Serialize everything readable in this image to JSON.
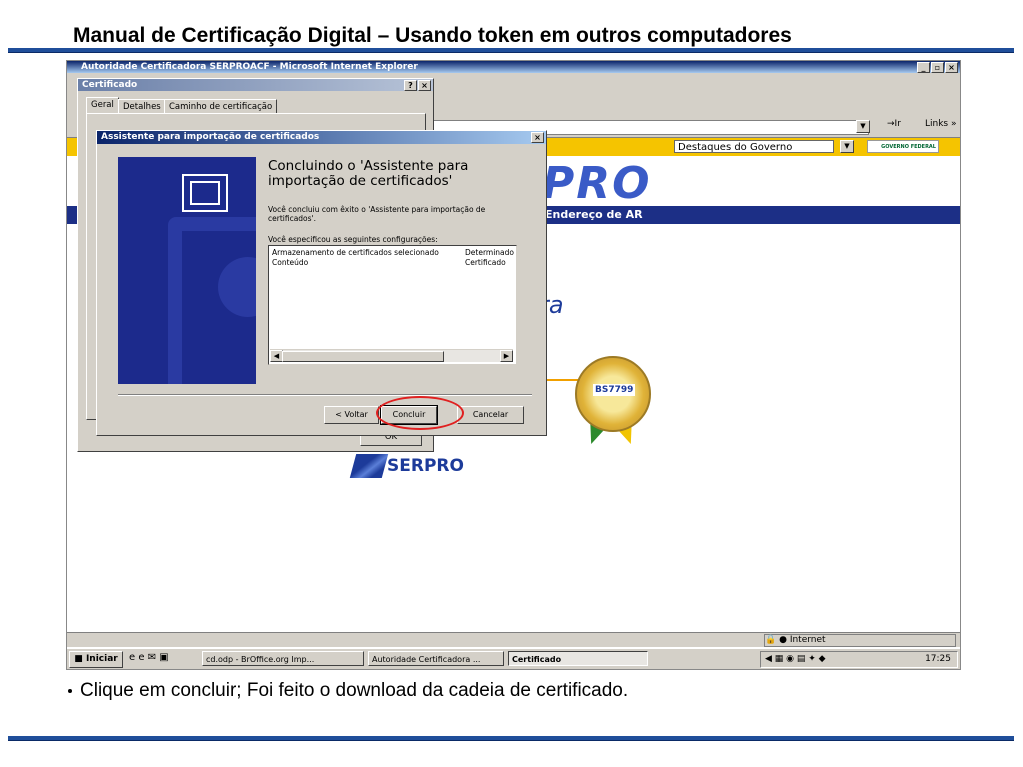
{
  "slide": {
    "title": "Manual de Certificação Digital – Usando token em outros computadores",
    "bullet": "Clique em concluir; Foi feito o download da cadeia de certificado."
  },
  "ie": {
    "window_title": "Autoridade Certificadora SERPROACF - Microsoft Internet Explorer",
    "go_label": "Ir",
    "links_label": "Links",
    "status_zone": "Internet"
  },
  "website": {
    "gov_select": "Destaques do Governo",
    "gov_badge": "GOVERNO FEDERAL",
    "logo_big": "PRO",
    "nav_item": "Endereço de AR",
    "ra_fragment": "ra",
    "seal_text": "BS7799",
    "serpro_logo": "SERPRO"
  },
  "cert_dialog": {
    "title": "Certificado",
    "tabs": [
      "Geral",
      "Detalhes",
      "Caminho de certificação"
    ],
    "ok_label": "OK"
  },
  "wizard": {
    "title": "Assistente para importação de certificados",
    "heading": "Concluindo o 'Assistente para importação de certificados'",
    "para1": "Você concluiu com êxito o 'Assistente para importação de certificados'.",
    "para2": "Você especificou as seguintes configurações:",
    "settings": [
      {
        "name": "Armazenamento de certificados selecionado",
        "value": "Determinado"
      },
      {
        "name": "Conteúdo",
        "value": "Certificado"
      }
    ],
    "back_label": "< Voltar",
    "finish_label": "Concluir",
    "cancel_label": "Cancelar"
  },
  "taskbar": {
    "start_label": "Iniciar",
    "items": [
      "cd.odp - BrOffice.org Imp...",
      "Autoridade Certificadora ...",
      "Certificado"
    ],
    "clock": "17:25"
  },
  "colors": {
    "title_blue": "#0a246a",
    "window_face": "#d4d0c8",
    "rule_blue": "#1f4e9a",
    "highlight_red": "#e02020",
    "wizard_art": "#1c2a8c"
  }
}
